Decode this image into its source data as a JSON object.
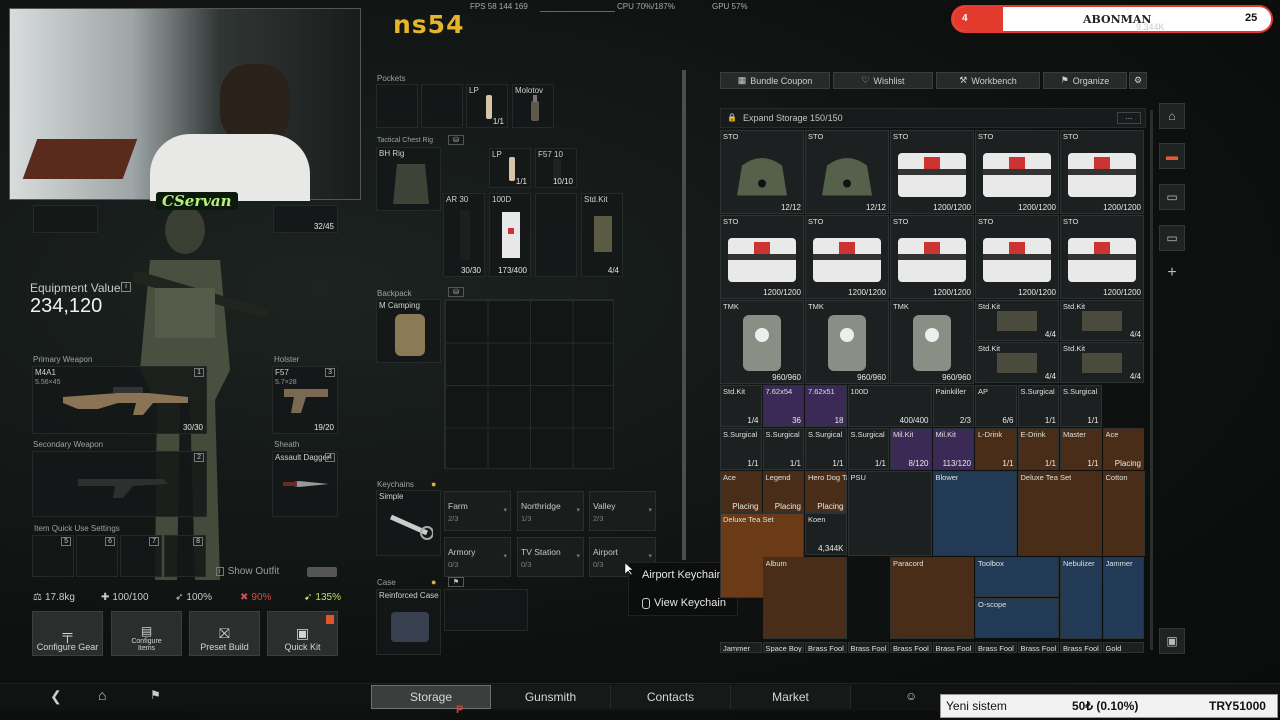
{
  "overlay": {
    "channel_logo": "ns54",
    "perf": "FPS 58   144 169",
    "cpu": "CPU 70%/187%",
    "gpu": "GPU 57%",
    "webcam_name": "CServan",
    "sub_left": "4",
    "sub_label": "ABONMAN",
    "sub_right": "25",
    "sub_sub": "9.344K",
    "ticker_left": "Yeni sistem",
    "ticker_mid": "50₺ (0.10%)",
    "ticker_right": "TRY51000"
  },
  "equipment": {
    "value_label": "Equipment Value",
    "value": "234,120",
    "primary_label": "Primary Weapon",
    "primary_name": "M4A1",
    "primary_cal": "5.56×45",
    "primary_count": "30/30",
    "primary_idx": "1",
    "holster_label": "Holster",
    "holster_name": "F57",
    "holster_cal": "5.7×28",
    "holster_count": "19/20",
    "holster_idx": "3",
    "secondary_label": "Secondary Weapon",
    "secondary_idx": "2",
    "sheath_label": "Sheath",
    "sheath_name": "Assault Dagger",
    "sheath_idx": "4",
    "top_count": "32/45",
    "quick_label": "Item Quick Use Settings",
    "quick_slots": [
      "5",
      "6",
      "7",
      "8"
    ],
    "show_outfit": "Show Outfit"
  },
  "stats": {
    "weight": "17.8kg",
    "health": "100/100",
    "stamina": "100%",
    "hydration": "90%",
    "energy": "135%"
  },
  "actions": {
    "configure_gear": "Configure Gear",
    "configure_items": "Configure Items",
    "preset_build": "Preset Build",
    "quick_kit": "Quick Kit"
  },
  "loadout": {
    "pockets": "Pockets",
    "lp": "LP",
    "lp_count": "1/1",
    "molotov": "Molotov",
    "rig_label": "Tactical Chest Rig",
    "rig_name": "BH Rig",
    "rig_lp": "LP",
    "rig_lp_count": "1/1",
    "f57_mag": "F57 10",
    "f57_mag_count": "10/10",
    "ar30": "AR 30",
    "ar30_count": "30/30",
    "bandage": "100D",
    "bandage_count": "173/400",
    "stdkit": "Std.Kit",
    "stdkit_count": "4/4",
    "backpack_label": "Backpack",
    "backpack_name": "M Camping",
    "keychains_label": "Keychains",
    "keychain_name": "Simple",
    "keys": [
      {
        "name": "Farm",
        "sub": "2/3"
      },
      {
        "name": "Northridge",
        "sub": "1/3"
      },
      {
        "name": "Valley",
        "sub": "2/3"
      },
      {
        "name": "Armory",
        "sub": "0/3"
      },
      {
        "name": "TV Station",
        "sub": "0/3"
      },
      {
        "name": "Airport",
        "sub": "0/3"
      }
    ],
    "case_label": "Case",
    "case_name": "Reinforced Case"
  },
  "context_menu": {
    "item1": "Airport Keychain",
    "item2": "View Keychain"
  },
  "storage": {
    "tabs": [
      "Bundle Coupon",
      "Wishlist",
      "Workbench",
      "Organize"
    ],
    "header": "Expand Storage  150/150",
    "cells": [
      {
        "l": "STO",
        "c": "12/12",
        "t": "bag"
      },
      {
        "l": "STO",
        "c": "12/12",
        "t": "bag"
      },
      {
        "l": "STO",
        "c": "1200/1200",
        "t": "box"
      },
      {
        "l": "STO",
        "c": "1200/1200",
        "t": "box"
      },
      {
        "l": "STO",
        "c": "1200/1200",
        "t": "box"
      },
      {
        "l": "STO",
        "c": "1200/1200",
        "t": "box"
      },
      {
        "l": "STO",
        "c": "1200/1200",
        "t": "box"
      },
      {
        "l": "STO",
        "c": "1200/1200",
        "t": "box"
      },
      {
        "l": "STO",
        "c": "1200/1200",
        "t": "box"
      },
      {
        "l": "STO",
        "c": "1200/1200",
        "t": "box"
      },
      {
        "l": "TMK",
        "c": "960/960",
        "t": "med"
      },
      {
        "l": "TMK",
        "c": "960/960",
        "t": "med"
      },
      {
        "l": "TMK",
        "c": "960/960",
        "t": "med"
      }
    ],
    "stdkits": [
      {
        "l": "Std.Kit",
        "c": "4/4"
      },
      {
        "l": "Std.Kit",
        "c": "4/4"
      },
      {
        "l": "Std.Kit",
        "c": "4/4"
      },
      {
        "l": "Std.Kit",
        "c": "4/4"
      }
    ],
    "row_small1": [
      {
        "l": "Std.Kit",
        "c": "1/4"
      },
      {
        "l": "7.62x54",
        "c": "36"
      },
      {
        "l": "7.62x51",
        "c": "18"
      },
      {
        "l": "100D",
        "c": "400/400"
      },
      {
        "l": "Painkiller",
        "c": "2/3"
      },
      {
        "l": "AP",
        "c": "6/6"
      },
      {
        "l": "S.Surgical",
        "c": "1/1"
      },
      {
        "l": "S.Surgical",
        "c": "1/1"
      }
    ],
    "row_small2": [
      {
        "l": "S.Surgical",
        "c": "1/1"
      },
      {
        "l": "S.Surgical",
        "c": "1/1"
      },
      {
        "l": "S.Surgical",
        "c": "1/1"
      },
      {
        "l": "S.Surgical",
        "c": "1/1"
      },
      {
        "l": "Mil.Kit",
        "c": "8/120"
      },
      {
        "l": "Mil.Kit",
        "c": "113/120"
      },
      {
        "l": "L-Drink",
        "c": "1/1"
      },
      {
        "l": "E-Drink",
        "c": "1/1"
      },
      {
        "l": "Master",
        "c": "1/1"
      },
      {
        "l": "Ace",
        "c": "Placing"
      }
    ],
    "row_small3": [
      {
        "l": "Ace",
        "c": "Placing"
      },
      {
        "l": "Legend",
        "c": "Placing"
      },
      {
        "l": "Hero Dog Tag",
        "c": "Placing"
      },
      {
        "l": "PSU",
        "c": ""
      },
      {
        "l": "Blower",
        "c": ""
      },
      {
        "l": "Deluxe Tea Set",
        "c": ""
      },
      {
        "l": "Cotton",
        "c": ""
      }
    ],
    "misc": {
      "deluxe": "Deluxe Tea Set",
      "koen": "Koen",
      "koen_c": "4,344K",
      "album": "Album",
      "paracord": "Paracord",
      "toolbox": "Toolbox",
      "oscope": "O-scope",
      "nebulizer": "Nebulizer",
      "jammer": "Jammer"
    },
    "bottom_labels": [
      "Jammer",
      "Space Boy",
      "Brass Fool",
      "Brass Fool",
      "Brass Fool",
      "Brass Fool",
      "Brass Fool",
      "Brass Fool",
      "Brass Fool",
      "Gold"
    ]
  },
  "nav": {
    "storage": "Storage",
    "gunsmith": "Gunsmith",
    "contacts": "Contacts",
    "market": "Market"
  },
  "colors": {
    "accent_red": "#e23b2e",
    "bg": "#0d0f0e",
    "rare_orange": "#6b3a16",
    "rare_purple": "#3b2a55",
    "rare_blue": "#223a55"
  }
}
